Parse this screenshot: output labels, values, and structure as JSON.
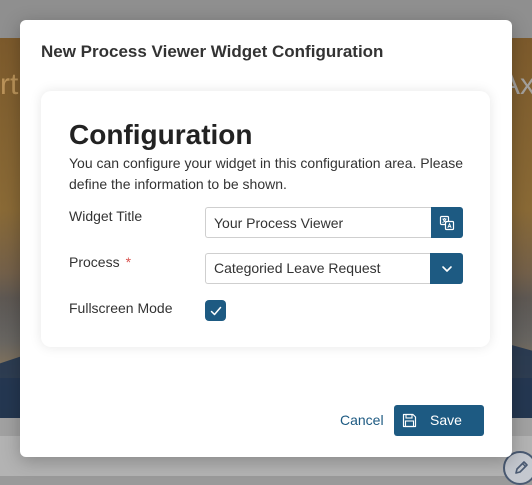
{
  "background": {
    "hero_text_left": "rt",
    "hero_text_right": "Ax"
  },
  "dialog": {
    "title": "New Process Viewer Widget Configuration"
  },
  "config": {
    "heading": "Configuration",
    "description": "You can configure your widget in this configuration area. Please define the information to be shown.",
    "widget_title": {
      "label": "Widget Title",
      "value": "Your Process Viewer",
      "addon_icon": "translate-icon"
    },
    "process": {
      "label": "Process",
      "required_marker": "*",
      "selected": "Categoried Leave Request",
      "addon_icon": "chevron-down-icon"
    },
    "fullscreen": {
      "label": "Fullscreen Mode",
      "checked": true
    }
  },
  "footer": {
    "cancel_label": "Cancel",
    "save_label": "Save",
    "save_icon": "floppy-disk-icon"
  },
  "colors": {
    "primary": "#1d5a82",
    "required": "#d9534f"
  }
}
